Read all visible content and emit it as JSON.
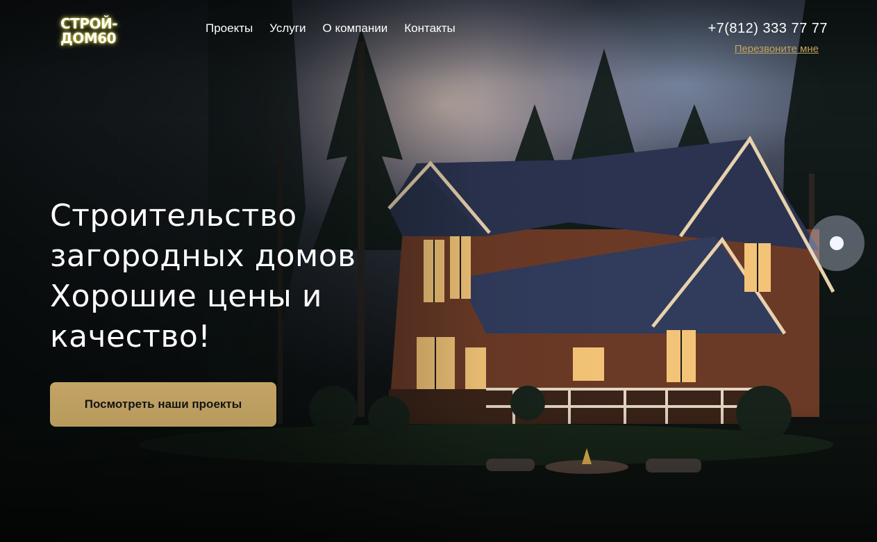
{
  "logo": {
    "line1": "СТРОЙ-",
    "line2": "ДОМ60"
  },
  "nav": {
    "items": [
      {
        "label": "Проекты"
      },
      {
        "label": "Услуги"
      },
      {
        "label": "О компании"
      },
      {
        "label": "Контакты"
      }
    ]
  },
  "contact": {
    "phone": "+7(812) 333 77 77",
    "callback_label": "Перезвоните мне"
  },
  "hero": {
    "title_lines": [
      "Строительство",
      "загородных домов",
      "Хорошие цены и",
      "качество!"
    ],
    "cta_label": "Посмотреть наши проекты"
  },
  "colors": {
    "accent": "#c6a25c",
    "button_bg": "#bfa062",
    "logo_glow": "#f0e650",
    "text": "#ffffff"
  },
  "background": {
    "icon": "night-forest-house-photo"
  }
}
